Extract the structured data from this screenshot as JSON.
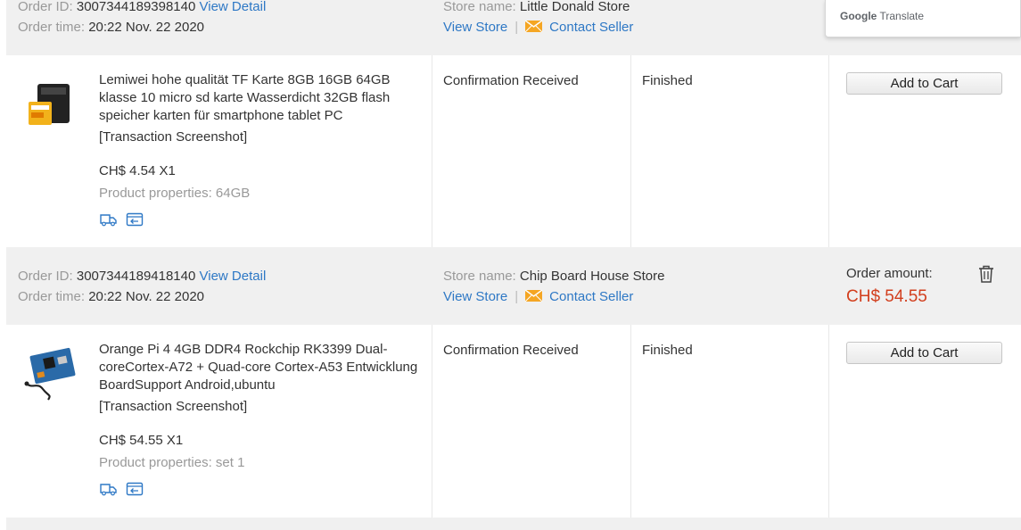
{
  "translate": {
    "brand": "Google",
    "product": "Translate"
  },
  "labels": {
    "order_id": "Order ID:",
    "order_time": "Order time:",
    "view_detail": "View Detail",
    "store_name": "Store name:",
    "view_store": "View Store",
    "separator": "|",
    "contact_seller": "Contact Seller",
    "order_amount": "Order amount:",
    "transaction_screenshot": "[Transaction Screenshot]",
    "product_properties": "Product properties:",
    "add_to_cart": "Add to Cart"
  },
  "colors": {
    "link": "#2e78c5",
    "amount": "#d23f1e",
    "header_bg": "#f0f0f0"
  },
  "orders": [
    {
      "order_id": "3007344189398140",
      "order_time": "20:22 Nov. 22 2020",
      "store": "Little Donald Store",
      "item": {
        "title": "Lemiwei hohe qualität TF Karte 8GB 16GB 64GB klasse 10 micro sd karte Wasserdicht 32GB flash speicher karten für smartphone tablet PC",
        "price": "CH$ 4.54 X1",
        "properties": "64GB",
        "status": "Confirmation Received",
        "order_status": "Finished",
        "thumb_icon": "sd-card-icon"
      }
    },
    {
      "order_id": "3007344189418140",
      "order_time": "20:22 Nov. 22 2020",
      "store": "Chip Board House Store",
      "amount": "CH$ 54.55",
      "item": {
        "title": "Orange Pi 4 4GB DDR4 Rockchip RK3399 Dual-coreCortex-A72 + Quad-core Cortex-A53 Entwicklung BoardSupport Android,ubuntu",
        "price": "CH$ 54.55 X1",
        "properties": "set 1",
        "status": "Confirmation Received",
        "order_status": "Finished",
        "thumb_icon": "circuit-board-icon"
      }
    }
  ]
}
